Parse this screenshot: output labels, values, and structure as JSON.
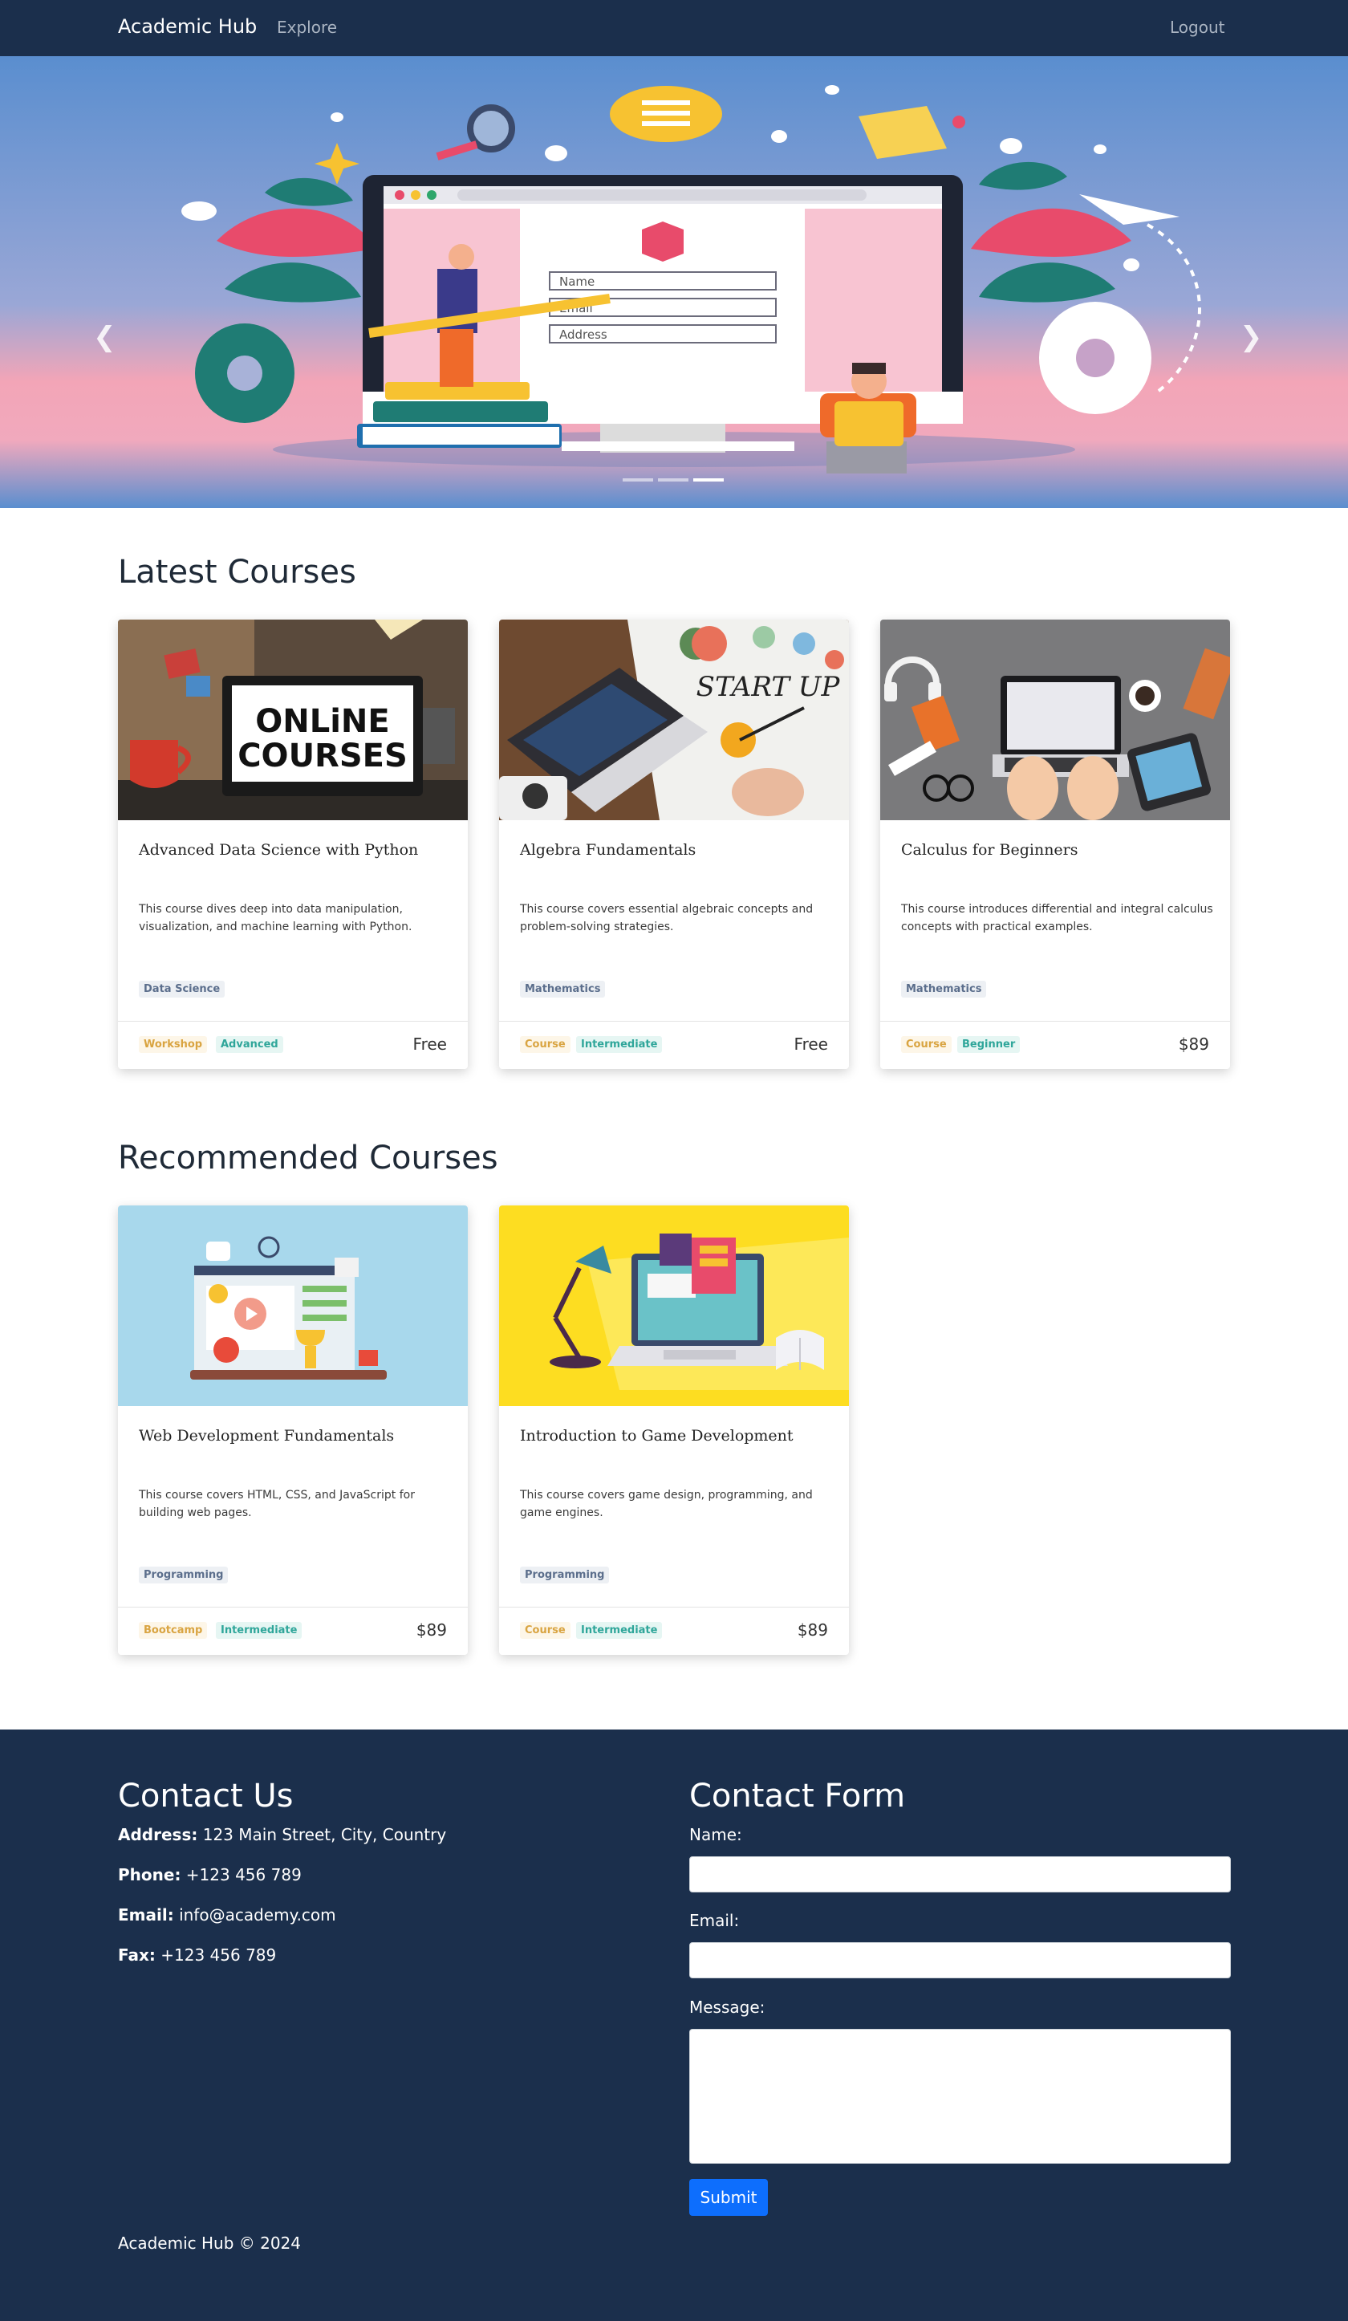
{
  "navbar": {
    "brand": "Academic Hub",
    "explore": "Explore",
    "logout": "Logout"
  },
  "hero": {
    "prev_icon": "chevron-left-icon",
    "next_icon": "chevron-right-icon",
    "slide_count": 3,
    "active_slide": 3,
    "form_fields": [
      "Name",
      "Email",
      "Address"
    ],
    "colors": {
      "sky": "#5b8fd0",
      "band": "#f4a6b8",
      "accent": "#e84b6b"
    }
  },
  "latest": {
    "title": "Latest Courses",
    "courses": [
      {
        "title": "Advanced Data Science with Python",
        "description": "This course dives deep into data manipulation, visualization, and machine learning with Python.",
        "subject": "Data Science",
        "type": "Workshop",
        "level": "Advanced",
        "price": "Free",
        "image_text_1": "ONLiNE",
        "image_text_2": "COURSES"
      },
      {
        "title": "Algebra Fundamentals",
        "description": "This course covers essential algebraic concepts and problem-solving strategies.",
        "subject": "Mathematics",
        "type": "Course",
        "level": "Intermediate",
        "price": "Free",
        "image_text_1": "START UP"
      },
      {
        "title": "Calculus for Beginners",
        "description": "This course introduces differential and integral calculus concepts with practical examples.",
        "subject": "Mathematics",
        "type": "Course",
        "level": "Beginner",
        "price": "$89"
      }
    ]
  },
  "recommended": {
    "title": "Recommended Courses",
    "courses": [
      {
        "title": "Web Development Fundamentals",
        "description": "This course covers HTML, CSS, and JavaScript for building web pages.",
        "subject": "Programming",
        "type": "Bootcamp",
        "level": "Intermediate",
        "price": "$89"
      },
      {
        "title": "Introduction to Game Development",
        "description": "This course covers game design, programming, and game engines.",
        "subject": "Programming",
        "type": "Course",
        "level": "Intermediate",
        "price": "$89"
      }
    ]
  },
  "footer": {
    "contact_title": "Contact Us",
    "address_label": "Address:",
    "address": "123 Main Street, City, Country",
    "phone_label": "Phone:",
    "phone": "+123 456 789",
    "email_label": "Email:",
    "email": "info@academy.com",
    "fax_label": "Fax:",
    "fax": "+123 456 789",
    "form_title": "Contact Form",
    "name_label": "Name:",
    "name_value": "",
    "email_field_label": "Email:",
    "email_value": "",
    "message_label": "Message:",
    "message_value": "",
    "submit": "Submit",
    "copyright": "Academic Hub © 2024"
  }
}
